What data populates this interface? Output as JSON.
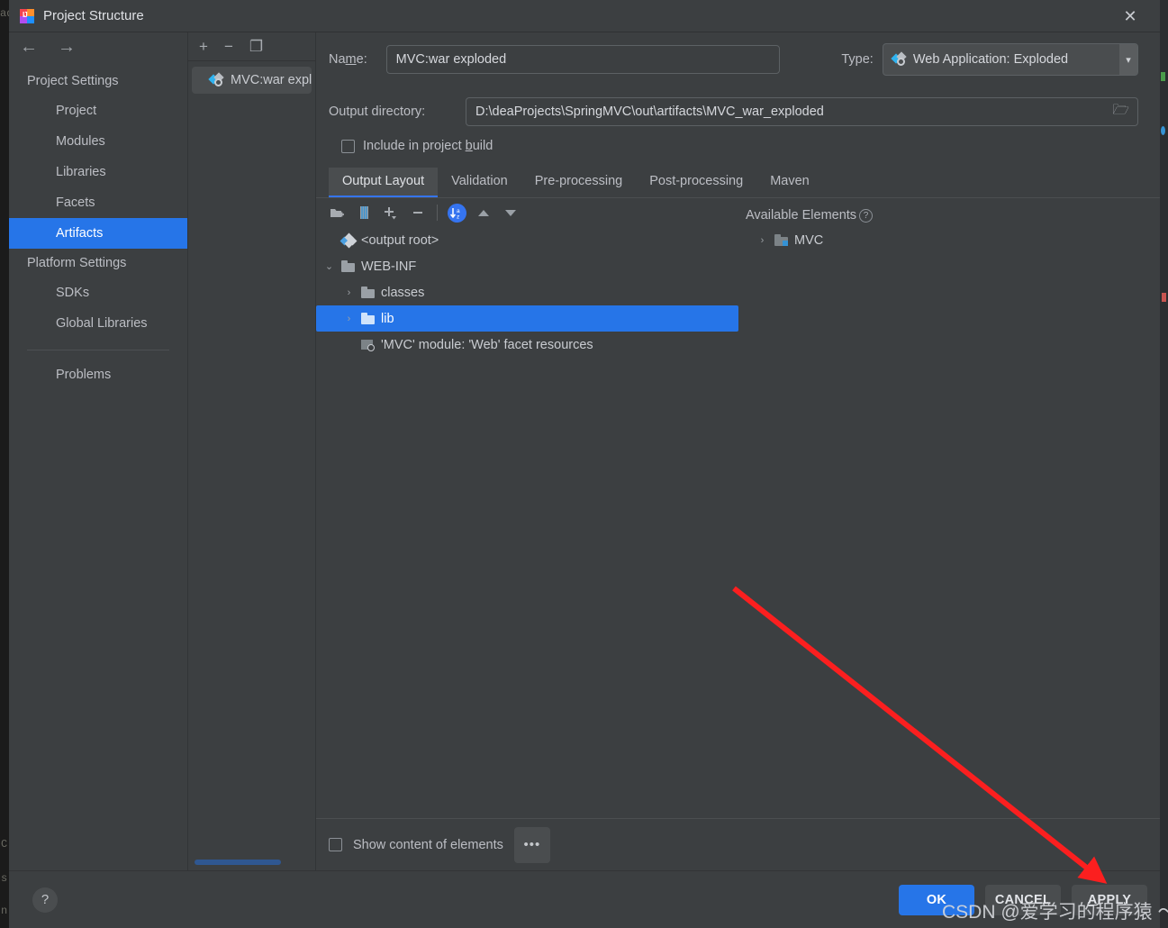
{
  "window": {
    "title": "Project Structure",
    "app_icon": "intellij-idea-icon",
    "close_label": "✕"
  },
  "nav": {
    "back_icon": "arrow-left-icon",
    "forward_icon": "arrow-right-icon",
    "groups": [
      {
        "label": "Project Settings",
        "items": [
          {
            "label": "Project",
            "selected": false
          },
          {
            "label": "Modules",
            "selected": false
          },
          {
            "label": "Libraries",
            "selected": false
          },
          {
            "label": "Facets",
            "selected": false
          },
          {
            "label": "Artifacts",
            "selected": true
          }
        ]
      },
      {
        "label": "Platform Settings",
        "items": [
          {
            "label": "SDKs",
            "selected": false
          },
          {
            "label": "Global Libraries",
            "selected": false
          }
        ]
      }
    ],
    "extra_items": [
      {
        "label": "Problems",
        "selected": false
      }
    ]
  },
  "artifacts": {
    "toolbar": [
      {
        "icon": "plus-icon",
        "label": "+"
      },
      {
        "icon": "minus-icon",
        "label": "−"
      },
      {
        "icon": "copy-icon",
        "label": "❐"
      }
    ],
    "items": [
      {
        "label": "MVC:war exploded",
        "icon": "artifact-icon",
        "selected": true
      }
    ]
  },
  "detail": {
    "name_label": "Na",
    "name_label_mnemonic": "m",
    "name_label_tail": "e:",
    "name_value": "MVC:war exploded",
    "type_label": "Type:",
    "type_value": "Web Application: Exploded",
    "type_icon": "artifact-icon",
    "output_dir_label": "Output directory:",
    "output_dir_value": "D:\\deaProjects\\SpringMVC\\out\\artifacts\\MVC_war_exploded",
    "folder_browse_icon": "folder-open-icon",
    "include_in_build_head": "Include in project ",
    "include_in_build_mnemonic": "b",
    "include_in_build_tail": "uild",
    "include_in_build_checked": false,
    "tabs": [
      {
        "label": "Output Layout",
        "active": true
      },
      {
        "label": "Validation",
        "active": false
      },
      {
        "label": "Pre-processing",
        "active": false
      },
      {
        "label": "Post-processing",
        "active": false
      },
      {
        "label": "Maven",
        "active": false
      }
    ],
    "tab_toolbar": [
      {
        "icon": "new-directory-icon"
      },
      {
        "icon": "add-archive-icon"
      },
      {
        "icon": "add-dropdown-icon"
      },
      {
        "icon": "remove-icon"
      },
      {
        "icon": "sort-az-icon",
        "label": "a z"
      },
      {
        "icon": "move-up-icon"
      },
      {
        "icon": "move-down-icon"
      }
    ],
    "tree": [
      {
        "label": "<output root>",
        "icon": "output-root-icon",
        "indent": 0,
        "twist": "",
        "selected": false
      },
      {
        "label": "WEB-INF",
        "icon": "folder-icon",
        "indent": 1,
        "twist": "⌄",
        "selected": false
      },
      {
        "label": "classes",
        "icon": "folder-icon",
        "indent": 2,
        "twist": "›",
        "selected": false
      },
      {
        "label": "lib",
        "icon": "folder-icon",
        "indent": 2,
        "twist": "›",
        "selected": true
      },
      {
        "label": "'MVC' module: 'Web' facet resources",
        "icon": "web-facet-icon",
        "indent": 2,
        "twist": "",
        "selected": false
      }
    ],
    "available_elements_label": "Available Elements",
    "available_help_icon": "help-icon",
    "available_tree": [
      {
        "label": "MVC",
        "icon": "module-icon",
        "twist": "›"
      }
    ],
    "show_content_label": "Show content of elements",
    "show_content_checked": false,
    "more_button_label": "•••"
  },
  "footer": {
    "help_label": "?",
    "buttons": [
      {
        "label": "OK",
        "style": "primary",
        "mnemonic": ""
      },
      {
        "label": "CANCEL",
        "style": "normal",
        "mnemonic": ""
      },
      {
        "label": "PPLY",
        "style": "normal",
        "mnemonic": "A"
      }
    ]
  },
  "annotation": {
    "arrow_color": "#fb1f1f",
    "watermark": "CSDN @爱学习的程序猿 ～"
  },
  "background": {
    "left_fragments": [
      "ad",
      "C",
      "s",
      "n"
    ],
    "right_strip_color": "#2b2d30"
  },
  "colors": {
    "accent": "#2675e8",
    "dialog_bg": "#3c3f41",
    "text": "#bcbec4",
    "annotation_red": "#fb1f1f"
  }
}
